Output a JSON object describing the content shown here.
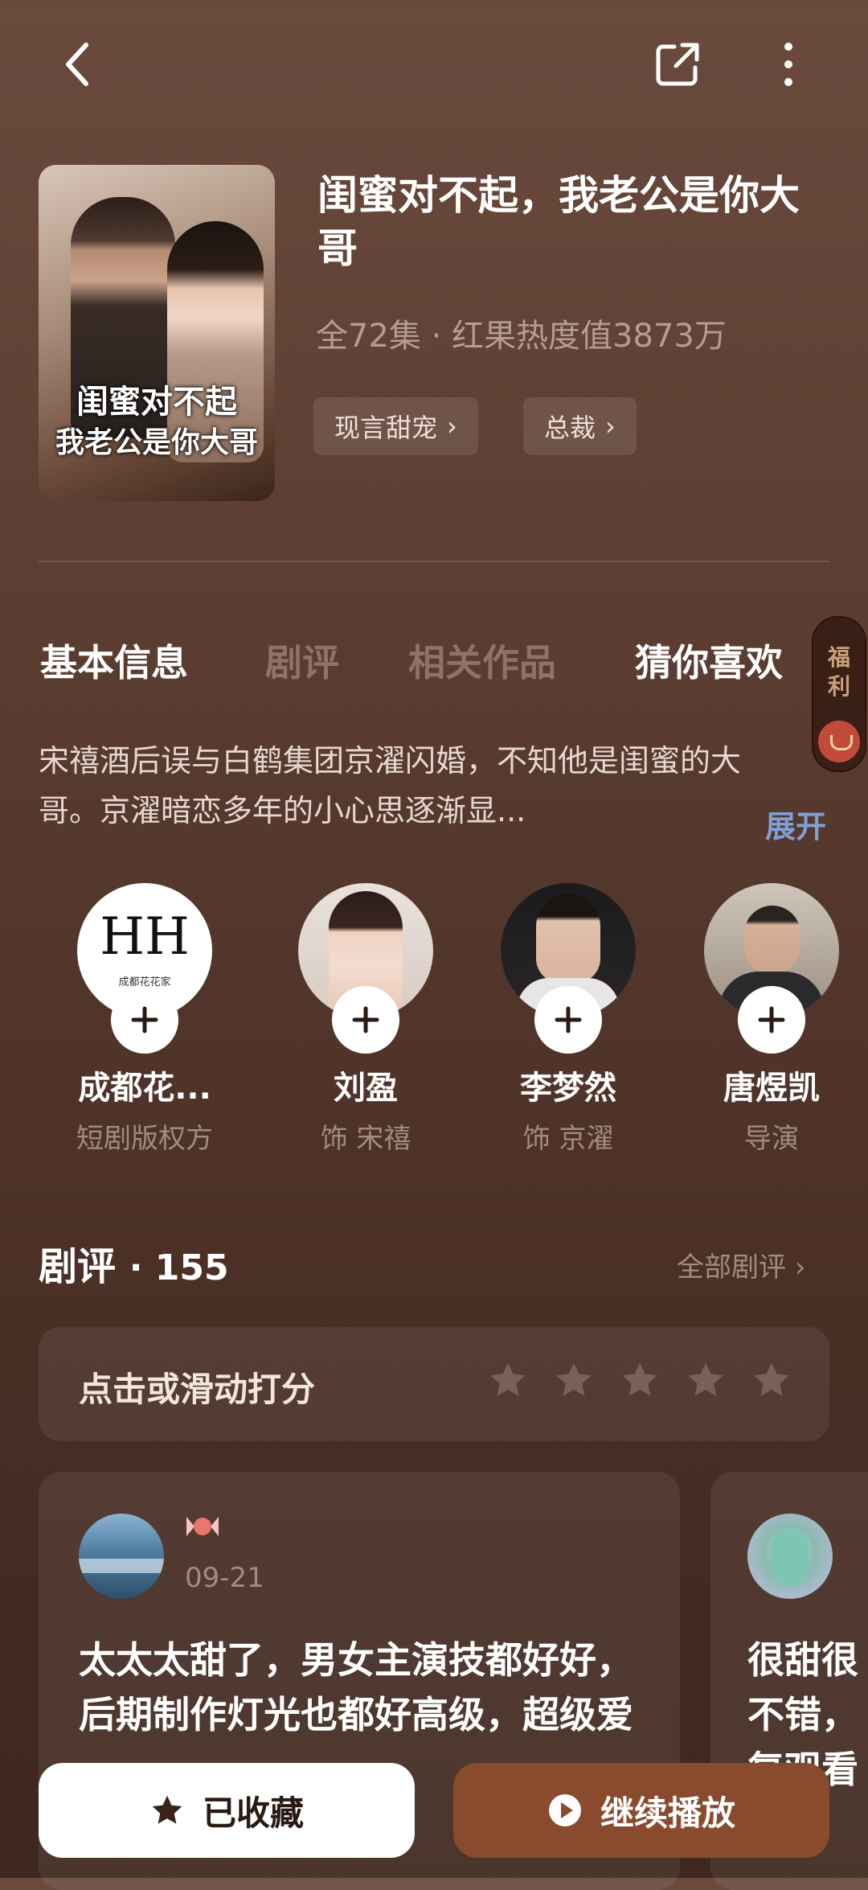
{
  "header": {
    "back_icon": "back-arrow-icon",
    "share_icon": "share-icon",
    "more_icon": "more-vertical-icon"
  },
  "drama": {
    "poster_title_line1": "闺蜜对不起",
    "poster_title_line2": "我老公是你大哥",
    "title": "闺蜜对不起，我老公是你大哥",
    "meta": "全72集 · 红果热度值3873万",
    "tags": [
      "现言甜宠",
      "总裁"
    ]
  },
  "tabs": [
    "基本信息",
    "剧评",
    "相关作品",
    "猜你喜欢"
  ],
  "welfare": {
    "label_1": "福",
    "label_2": "利"
  },
  "synopsis": {
    "text": "宋禧酒后误与白鹤集团京濯闪婚，不知他是闺蜜的大哥。京濯暗恋多年的小心思逐渐显...",
    "expand_label": "展开"
  },
  "cast": [
    {
      "name": "成都花...",
      "role": "短剧版权方",
      "logo_text": "HH",
      "logo_sub": "成都花花家"
    },
    {
      "name": "刘盈",
      "role": "饰 宋禧"
    },
    {
      "name": "李梦然",
      "role": "饰 京濯"
    },
    {
      "name": "唐煜凯",
      "role": "导演"
    }
  ],
  "reviews_section": {
    "title": "剧评",
    "count": "· 155",
    "all_label": "全部剧评",
    "rating_prompt": "点击或滑动打分",
    "rating_value": 0,
    "rating_max": 5
  },
  "reviews": [
    {
      "date": "09-21",
      "text": "太太太甜了，男女主演技都好好，后期制作灯光也都好高级，超级爱🧧🧧..."
    },
    {
      "date": "",
      "text": "很甜很不错，复观看"
    }
  ],
  "bottom": {
    "collect_label": "已收藏",
    "play_label": "继续播放"
  },
  "colors": {
    "accent": "#8a4a2e",
    "link": "#7f9fd6"
  }
}
